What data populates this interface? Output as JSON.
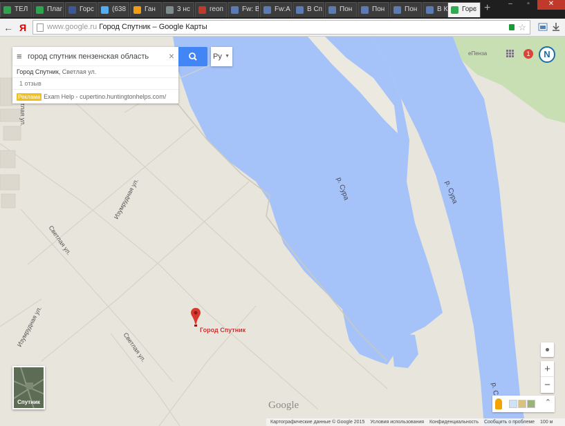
{
  "browser": {
    "tabs": [
      {
        "label": "TEЛ",
        "icon_color": "#2ea44f"
      },
      {
        "label": "Плаг",
        "icon_color": "#2ea44f"
      },
      {
        "label": "Горс",
        "icon_color": "#3b5998"
      },
      {
        "label": "(638",
        "icon_color": "#55acee"
      },
      {
        "label": "Ган",
        "icon_color": "#f39c12"
      },
      {
        "label": "3 нс",
        "icon_color": "#7f8c8d"
      },
      {
        "label": "геоп",
        "icon_color": "#c0392b"
      },
      {
        "label": "Fw: B",
        "icon_color": "#5b7bb4"
      },
      {
        "label": "Fw:A",
        "icon_color": "#5b7bb4"
      },
      {
        "label": "В Сп",
        "icon_color": "#5b7bb4"
      },
      {
        "label": "Пон",
        "icon_color": "#5b7bb4"
      },
      {
        "label": "Пон",
        "icon_color": "#5b7bb4"
      },
      {
        "label": "Пон",
        "icon_color": "#5b7bb4"
      },
      {
        "label": "В Ку",
        "icon_color": "#5b7bb4"
      },
      {
        "label": "Горс",
        "icon_color": "#34a853"
      }
    ],
    "new_tab": "+",
    "back_icon": "arrow-left-icon",
    "yandex_icon": "Я",
    "url_host": "www.google.ru",
    "url_title": "Город Спутник – Google Карты"
  },
  "map": {
    "search": {
      "value": "город спутник пензенская область",
      "clear": "×",
      "menu": "≡"
    },
    "lang": "Ру",
    "results": {
      "address_bold": "Город Спутник,",
      "address_rest": " Светлая ул.",
      "reviews": "1 отзыв",
      "ad_badge": "Реклама",
      "ad_text": "Exam Help - cupertino.huntingtonhelps.com/"
    },
    "header": {
      "place": "еПенза",
      "notifications": "1",
      "avatar_letter": "N"
    },
    "pin_label": "Город Спутник",
    "river_labels": [
      "р. Сура",
      "р. Сура",
      "р. С"
    ],
    "streets": [
      "Светлая ул.",
      "Изумрудная ул.",
      "Светлая ул.",
      "Изумрудная ул.",
      "Светлая ул.",
      "Светлая ул."
    ],
    "satellite_label": "Спутник",
    "zoom_in": "+",
    "zoom_out": "−",
    "expand": "⌃",
    "google_logo": "Google",
    "footer": [
      "Картографические данные © Google 2015",
      "Условия использования",
      "Конфиденциальность",
      "Сообщить о проблеме",
      "100 м"
    ],
    "colors": {
      "land": "#e8e5dc",
      "water": "#a5c3f8",
      "sand": "#ece9e1",
      "park": "#c8dfb4",
      "search_blue": "#4285f4",
      "pin_red": "#d9382f"
    }
  }
}
